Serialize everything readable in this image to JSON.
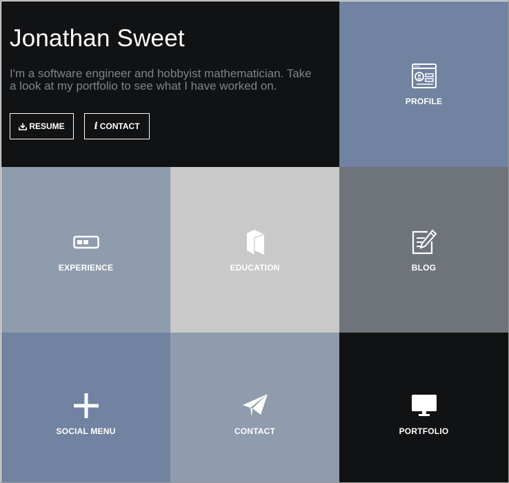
{
  "hero": {
    "name": "Jonathan Sweet",
    "description": "I'm a software engineer and hobbyist mathematician. Take a look at my portfolio to see what I have worked on.",
    "buttons": {
      "resume": {
        "label": "RESUME",
        "icon": "download-icon"
      },
      "contact": {
        "label": "CONTACT",
        "icon": "info-icon"
      }
    }
  },
  "tiles": {
    "profile": {
      "label": "PROFILE",
      "icon": "profile-card-icon",
      "color": "#7183a0"
    },
    "experience": {
      "label": "EXPERIENCE",
      "icon": "progress-bar-icon",
      "color": "#8f9cad"
    },
    "education": {
      "label": "EDUCATION",
      "icon": "book-icon",
      "color": "#c9c9c9"
    },
    "blog": {
      "label": "BLOG",
      "icon": "edit-note-icon",
      "color": "#6f747b"
    },
    "social": {
      "label": "SOCIAL MENU",
      "icon": "plus-icon",
      "color": "#7183a0"
    },
    "contact": {
      "label": "CONTACT",
      "icon": "paper-plane-icon",
      "color": "#8f9cad"
    },
    "portfolio": {
      "label": "PORTFOLIO",
      "icon": "monitor-icon",
      "color": "#111214"
    }
  },
  "colors": {
    "dark": "#111214",
    "muted_text": "#7f838c",
    "white": "#ffffff"
  }
}
